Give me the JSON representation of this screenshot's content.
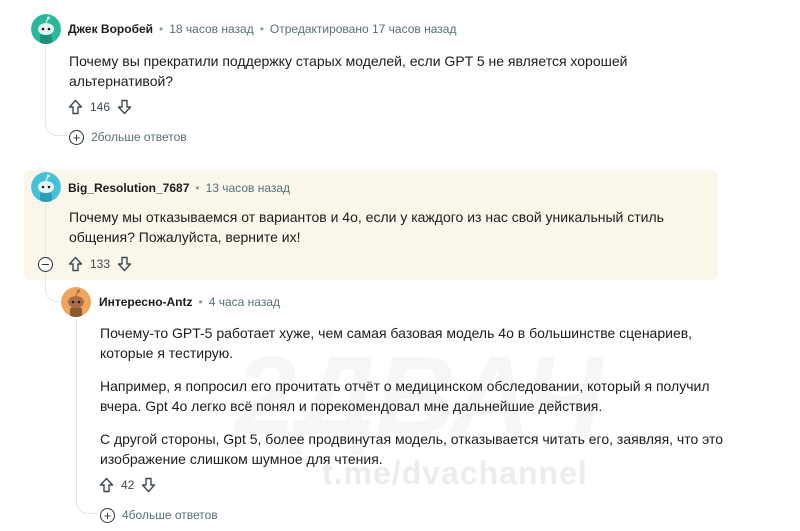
{
  "comments": [
    {
      "username": "Джек Воробей",
      "time": "18 часов назад",
      "edited": "Отредактировано 17 часов назад",
      "text_lines": [
        "Почему вы прекратили поддержку старых моделей, если GPT 5 не является хорошей",
        "альтернативой?"
      ],
      "votes": "146",
      "more_replies": "2больше ответов",
      "avatar_color": "#2bb89a"
    },
    {
      "username": "Big_Resolution_7687",
      "time": "13 часов назад",
      "text_lines": [
        "Почему мы отказываемся от вариантов и 4о, если у каждого из нас свой уникальный стиль",
        "общения? Пожалуйста, верните их!"
      ],
      "votes": "133",
      "avatar_color": "#45c1d8"
    },
    {
      "username": "Интересно-Antz",
      "time": "4 часа назад",
      "paragraphs": [
        [
          "Почему-то GPT-5 работает хуже, чем самая базовая модель 4о в большинстве сценариев,",
          "которые я тестирую."
        ],
        [
          "Например, я попросил его прочитать отчёт о медицинском обследовании, который я получил",
          "вчера. Gpt 4о легко всё понял и порекомендовал мне дальнейшие действия."
        ],
        [
          "С другой стороны, Gpt 5, более продвинутая модель, отказывается читать его, заявляя, что это",
          "изображение слишком шумное для чтения."
        ]
      ],
      "votes": "42",
      "more_replies": "4больше ответов",
      "avatar_color": "#f0a45c"
    }
  ],
  "watermark": "t.me/dvachannel",
  "watermark_logo": "2ДВАЧ",
  "colors": {
    "highlight": "#fbf6ea",
    "meta": "#576f76",
    "line": "#e3e6e8"
  }
}
